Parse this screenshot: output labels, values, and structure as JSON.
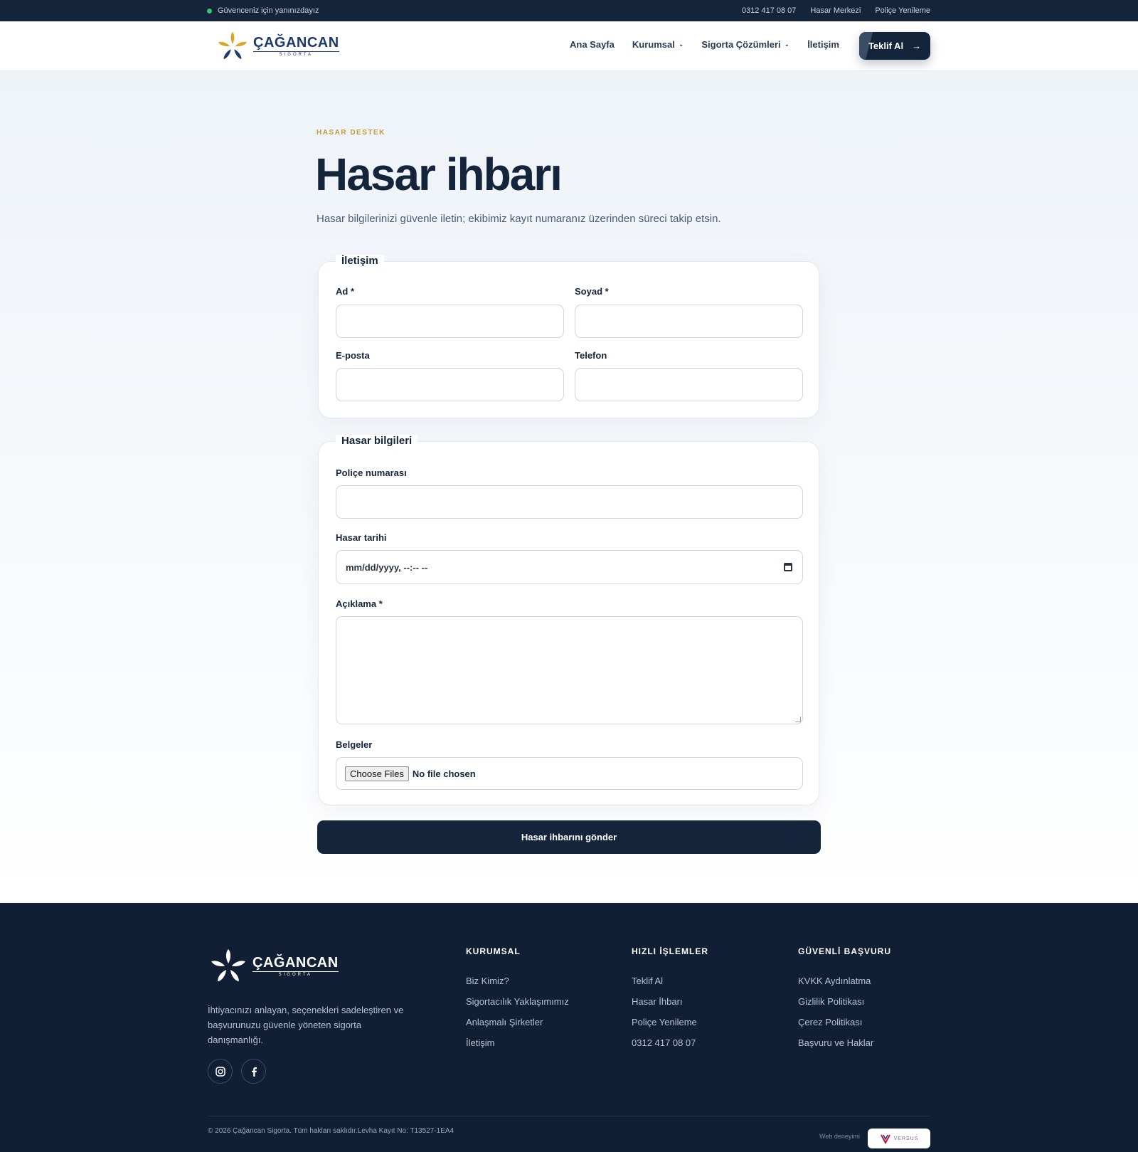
{
  "topbar": {
    "tagline": "Güvenceniz için yanınızdayız",
    "phone": "0312 417 08 07",
    "claims_center": "Hasar Merkezi",
    "policy_renewal": "Poliçe Yenileme"
  },
  "header": {
    "logo_name": "ÇAĞANCAN",
    "logo_sub": "SIGORTA",
    "nav": {
      "home": "Ana Sayfa",
      "corporate": "Kurumsal",
      "solutions": "Sigorta Çözümleri",
      "contact": "İletişim"
    },
    "cta_label": "Teklif Al",
    "cta_arrow": "→"
  },
  "page": {
    "eyebrow": "HASAR DESTEK",
    "title": "Hasar ihbarı",
    "subtitle": "Hasar bilgilerinizi güvenle iletin; ekibimiz kayıt numaranız üzerinden süreci takip etsin."
  },
  "contact_section": {
    "legend": "İletişim",
    "first_name_label": "Ad *",
    "last_name_label": "Soyad *",
    "email_label": "E-posta",
    "phone_label": "Telefon"
  },
  "claim_section": {
    "legend": "Hasar bilgileri",
    "policy_label": "Poliçe numarası",
    "date_label": "Hasar tarihi",
    "date_placeholder": "mm/dd/yyyy, --:-- --",
    "description_label": "Açıklama *",
    "documents_label": "Belgeler",
    "choose_files": "Choose Files",
    "no_file": "No file chosen"
  },
  "submit_label": "Hasar ihbarını gönder",
  "footer": {
    "logo_name": "ÇAĞANCAN",
    "logo_sub": "SIGORTA",
    "description": "İhtiyacınızı anlayan, seçenekleri sadeleştiren ve başvurunuzu güvenle yöneten sigorta danışmanlığı.",
    "col1": {
      "title": "KURUMSAL",
      "links": [
        "Biz Kimiz?",
        "Sigortacılık Yaklaşımımız",
        "Anlaşmalı Şirketler",
        "İletişim"
      ]
    },
    "col2": {
      "title": "HIZLI İŞLEMLER",
      "links": [
        "Teklif Al",
        "Hasar İhbarı",
        "Poliçe Yenileme",
        "0312 417 08 07"
      ]
    },
    "col3": {
      "title": "GÜVENLİ BAŞVURU",
      "links": [
        "KVKK Aydınlatma",
        "Gizlilik Politikası",
        "Çerez Politikası",
        "Başvuru ve Haklar"
      ]
    },
    "copyright": "© 2026 Çağancan Sigorta. Tüm hakları saklıdır.Levha Kayıt No: T13527-1EA4",
    "web_experience": "Web deneyimi",
    "badge_text": "VERSUS"
  },
  "colors": {
    "navy": "#14243b",
    "gold": "#c29a3b",
    "logo_blue": "#1d3a6b"
  }
}
